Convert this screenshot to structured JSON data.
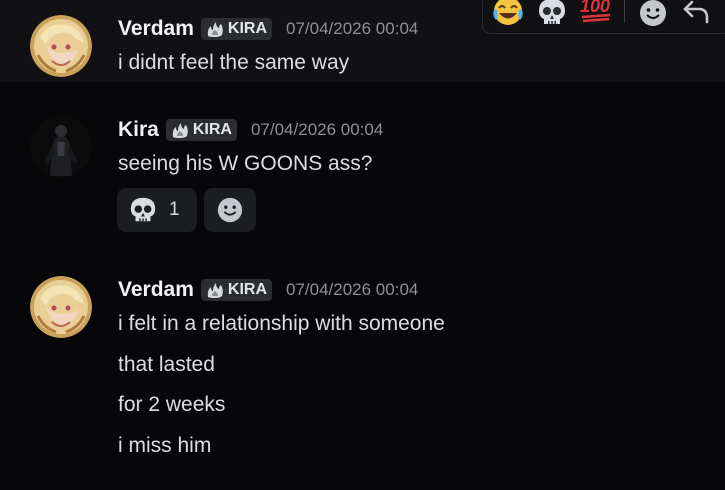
{
  "messages": [
    {
      "author": "Verdam",
      "tag": "KIRA",
      "timestamp": "07/04/2026 00:04",
      "lines": [
        "i didnt feel the same way"
      ]
    },
    {
      "author": "Kira",
      "tag": "KIRA",
      "timestamp": "07/04/2026 00:04",
      "lines": [
        "seeing his W GOONS ass?"
      ],
      "reactions": [
        {
          "emoji": "skull-icon",
          "count": "1"
        }
      ]
    },
    {
      "author": "Verdam",
      "tag": "KIRA",
      "timestamp": "07/04/2026 00:04",
      "lines": [
        "i felt in a relationship with someone",
        "that lasted",
        "for 2 weeks",
        "i miss him"
      ]
    }
  ],
  "hover_toolbar": {
    "quick_reactions": [
      "joy-emoji-icon",
      "skull-emoji-icon",
      "hundred-emoji-icon"
    ],
    "actions": [
      "add-reaction-icon",
      "reply-icon"
    ]
  },
  "colors": {
    "background": "#070709",
    "hovered_background": "#111114",
    "tag_background": "#2b2d31",
    "reaction_background": "#1c1d21",
    "timestamp": "#8d9096"
  }
}
